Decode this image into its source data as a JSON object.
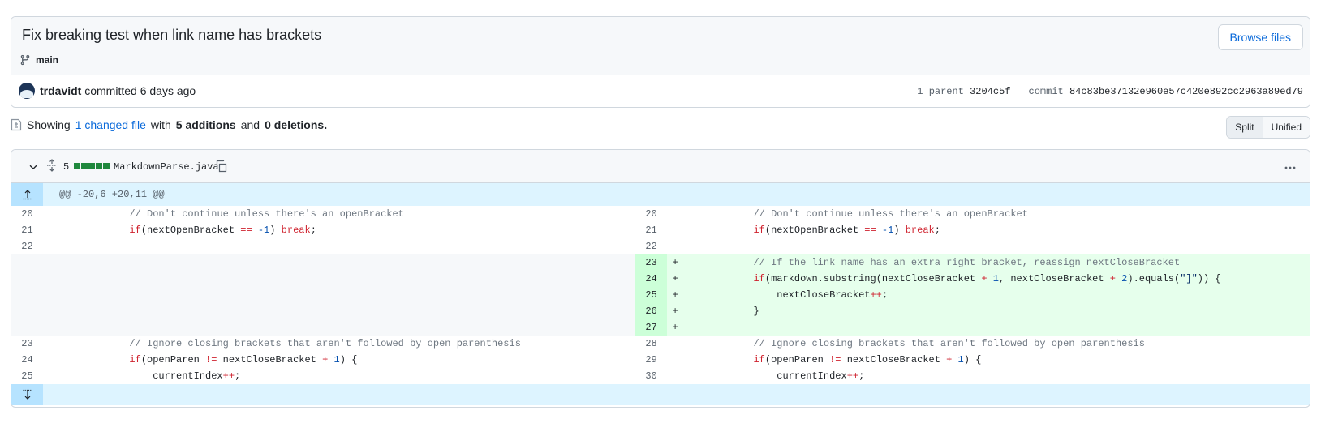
{
  "commit": {
    "title": "Fix breaking test when link name has brackets",
    "branch": "main",
    "browse_label": "Browse files",
    "author": "trdavidt",
    "committed_text": "committed 6 days ago",
    "parent_label": "1 parent",
    "parent_sha": "3204c5f",
    "commit_label": "commit",
    "commit_sha": "84c83be37132e960e57c420e892cc2963a89ed79"
  },
  "summary": {
    "showing": "Showing",
    "changed_files": "1 changed file",
    "with": "with",
    "additions": "5 additions",
    "and": "and",
    "deletions": "0 deletions",
    "period": "."
  },
  "view_toggle": {
    "split": "Split",
    "unified": "Unified",
    "selected": "Split"
  },
  "file": {
    "change_count": "5",
    "filename": "MarkdownParse.java",
    "hunk_header": "@@ -20,6 +20,11 @@"
  },
  "diff": {
    "left": [
      {
        "ln": "20",
        "type": "ctx"
      },
      {
        "ln": "21",
        "type": "ctx"
      },
      {
        "ln": "22",
        "type": "ctx"
      },
      {
        "ln": "",
        "type": "empty"
      },
      {
        "ln": "",
        "type": "empty"
      },
      {
        "ln": "",
        "type": "empty"
      },
      {
        "ln": "",
        "type": "empty"
      },
      {
        "ln": "",
        "type": "empty"
      },
      {
        "ln": "23",
        "type": "ctx"
      },
      {
        "ln": "24",
        "type": "ctx"
      },
      {
        "ln": "25",
        "type": "ctx"
      }
    ],
    "right": [
      {
        "ln": "20",
        "type": "ctx"
      },
      {
        "ln": "21",
        "type": "ctx"
      },
      {
        "ln": "22",
        "type": "ctx"
      },
      {
        "ln": "23",
        "type": "add"
      },
      {
        "ln": "24",
        "type": "add"
      },
      {
        "ln": "25",
        "type": "add"
      },
      {
        "ln": "26",
        "type": "add"
      },
      {
        "ln": "27",
        "type": "add"
      },
      {
        "ln": "28",
        "type": "ctx"
      },
      {
        "ln": "29",
        "type": "ctx"
      },
      {
        "ln": "30",
        "type": "ctx"
      }
    ],
    "code": {
      "comment_open": "// Don't continue unless there's an openBracket",
      "if_kw": "if",
      "next_open": "(nextOpenBracket ",
      "eq_op": "==",
      "neg_one": "-1",
      "close_paren": ") ",
      "break_kw": "break",
      "semicolon": ";",
      "add_comment": "// If the link name has an extra right bracket, reassign nextCloseBracket",
      "add_if_part1": "(markdown.substring(nextCloseBracket ",
      "plus": "+",
      "one": "1",
      "add_if_part2": ", nextCloseBracket ",
      "two": "2",
      "add_if_part3": ").equals(",
      "bracket_str": "\"]\"",
      "add_if_part4": ")) {",
      "add_incr": "nextCloseBracket",
      "incr_op": "++",
      "close_brace": "}",
      "plus_marker": "+",
      "ignore_comment": "// Ignore closing brackets that aren't followed by open parenthesis",
      "open_paren_cond": "(openParen ",
      "neq_op": "!=",
      "next_close": " nextCloseBracket ",
      "open_brace_end": ") {",
      "current_index": "currentIndex"
    }
  }
}
